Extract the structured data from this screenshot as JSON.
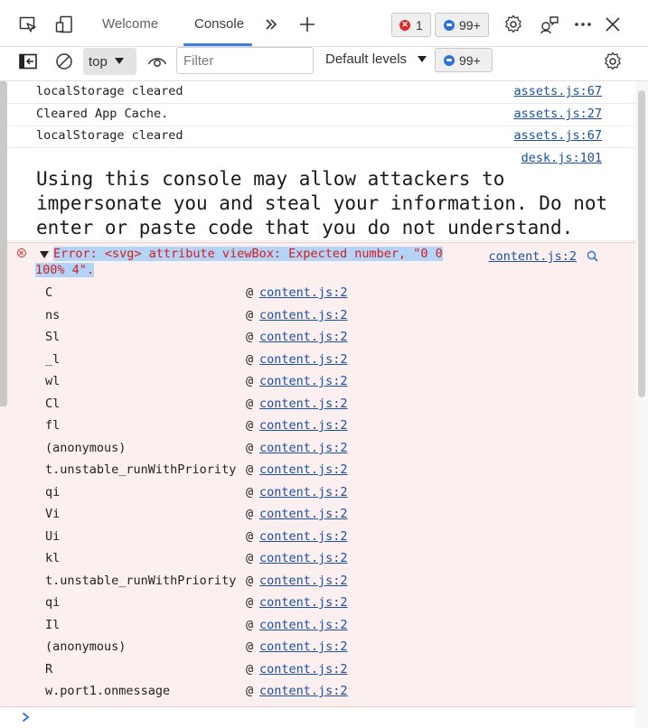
{
  "tabbar": {
    "tabs": [
      {
        "label": "Welcome"
      },
      {
        "label": "Console"
      }
    ],
    "error_count": "1",
    "message_count": "99+",
    "icons": [
      "device-inspect-icon",
      "device-emulation-icon",
      "more-tabs-icon",
      "add-tab-icon",
      "error-icon",
      "message-icon",
      "settings-icon",
      "feedback-icon",
      "more-icon",
      "close-icon"
    ]
  },
  "toolbar": {
    "context": "top",
    "filter_placeholder": "Filter",
    "levels_label": "Default levels",
    "message_count": "99+"
  },
  "logs": [
    {
      "text": "localStorage cleared",
      "source": "assets.js:67"
    },
    {
      "text": "Cleared App Cache.",
      "source": "assets.js:27"
    },
    {
      "text": "localStorage cleared",
      "source": "assets.js:67"
    }
  ],
  "warning": {
    "source": "desk.js:101",
    "text": "Using this console may allow attackers to impersonate you and steal your information. Do not enter or paste code that you do not understand."
  },
  "error": {
    "message": "Error: <svg> attribute viewBox: Expected number, \"0 0 100% 4\".",
    "source": "content.js:2",
    "stack": [
      {
        "fn": "C",
        "at": "@",
        "link": "content.js:2"
      },
      {
        "fn": "ns",
        "at": "@",
        "link": "content.js:2"
      },
      {
        "fn": "Sl",
        "at": "@",
        "link": "content.js:2"
      },
      {
        "fn": "_l",
        "at": "@",
        "link": "content.js:2"
      },
      {
        "fn": "wl",
        "at": "@",
        "link": "content.js:2"
      },
      {
        "fn": "Cl",
        "at": "@",
        "link": "content.js:2"
      },
      {
        "fn": "fl",
        "at": "@",
        "link": "content.js:2"
      },
      {
        "fn": "(anonymous)",
        "at": "@",
        "link": "content.js:2"
      },
      {
        "fn": "t.unstable_runWithPriority",
        "at": "@",
        "link": "content.js:2"
      },
      {
        "fn": "qi",
        "at": "@",
        "link": "content.js:2"
      },
      {
        "fn": "Vi",
        "at": "@",
        "link": "content.js:2"
      },
      {
        "fn": "Ui",
        "at": "@",
        "link": "content.js:2"
      },
      {
        "fn": "kl",
        "at": "@",
        "link": "content.js:2"
      },
      {
        "fn": "t.unstable_runWithPriority",
        "at": "@",
        "link": "content.js:2"
      },
      {
        "fn": "qi",
        "at": "@",
        "link": "content.js:2"
      },
      {
        "fn": "Il",
        "at": "@",
        "link": "content.js:2"
      },
      {
        "fn": "(anonymous)",
        "at": "@",
        "link": "content.js:2"
      },
      {
        "fn": "R",
        "at": "@",
        "link": "content.js:2"
      },
      {
        "fn": "w.port1.onmessage",
        "at": "@",
        "link": "content.js:2"
      }
    ]
  },
  "colors": {
    "accent": "#3b7ddd",
    "error_text": "#d81b1b",
    "error_background": "#fcefef",
    "link": "#1a4fa5"
  }
}
